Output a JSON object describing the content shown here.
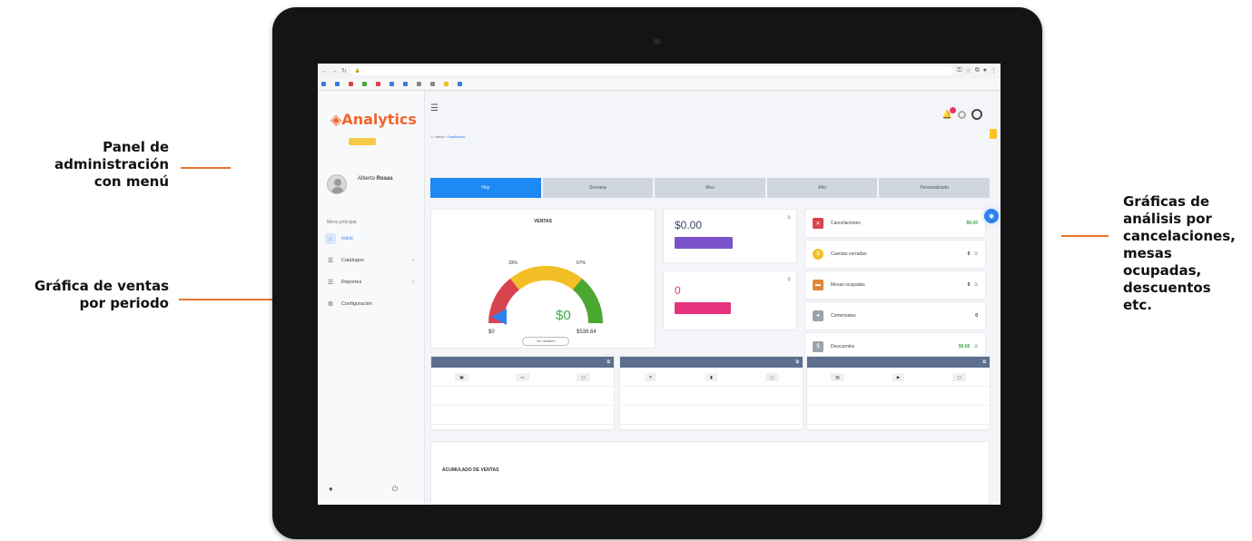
{
  "annotations": {
    "left_top": [
      "Panel de",
      "administración",
      "con menú"
    ],
    "left_bottom": [
      "Gráfica de ventas",
      "por periodo"
    ],
    "right": [
      "Gráficas de",
      "análisis por",
      "cancelaciones,",
      "mesas",
      "ocupadas,",
      "descuentos",
      "etc."
    ],
    "line_color": "#e8742a"
  },
  "app": {
    "logo": "Analytics",
    "user": {
      "first": "Alberto",
      "last": "Rosas"
    },
    "menu_title": "Menu principal",
    "menu": [
      {
        "label": "Inicio",
        "icon": "home-icon"
      },
      {
        "label": "Catálogos",
        "icon": "list-icon"
      },
      {
        "label": "Reportes",
        "icon": "report-icon"
      },
      {
        "label": "Configuración",
        "icon": "gear-icon"
      }
    ],
    "breadcrumb": {
      "home": "Inicio",
      "current": "Dashboard"
    },
    "tabs": [
      "Hoy",
      "Semana",
      "Mes",
      "Año",
      "Personalizado"
    ],
    "gauge": {
      "title": "VENTAS",
      "value": "$0",
      "min": "$0",
      "max": "$538.64",
      "pct_left": "33%",
      "pct_right": "67%",
      "button": "Ver detalles",
      "colors": {
        "low": "#d9444f",
        "mid": "#f3bf27",
        "high": "#4aa72f",
        "pointer": "#2f80ed"
      }
    },
    "mid_cards": [
      {
        "value": "$0.00",
        "pill_color": "#7b53c9"
      },
      {
        "value": "0",
        "pill_color": "#e6337e"
      }
    ],
    "stats": [
      {
        "label": "Cancelaciones",
        "value": "$0.00",
        "icon": "x-icon",
        "color": "#d9444f",
        "green": true
      },
      {
        "label": "Cuentas cerradas",
        "value": "0",
        "icon": "coin-icon",
        "color": "#f3bf27",
        "green": false
      },
      {
        "label": "Mesas ocupadas",
        "value": "0",
        "icon": "table-icon",
        "color": "#e0873a",
        "green": false
      },
      {
        "label": "Comensales",
        "value": "0",
        "icon": "person-icon",
        "color": "#9aa2ad",
        "green": false
      },
      {
        "label": "Descuentos",
        "value": "$0.00",
        "icon": "tag-icon",
        "color": "#9aa2ad",
        "green": true
      }
    ],
    "accent": "#1e88f5",
    "update_color": "#f7c52b",
    "bottom_title": "ACUMULADO DE VENTAS"
  }
}
